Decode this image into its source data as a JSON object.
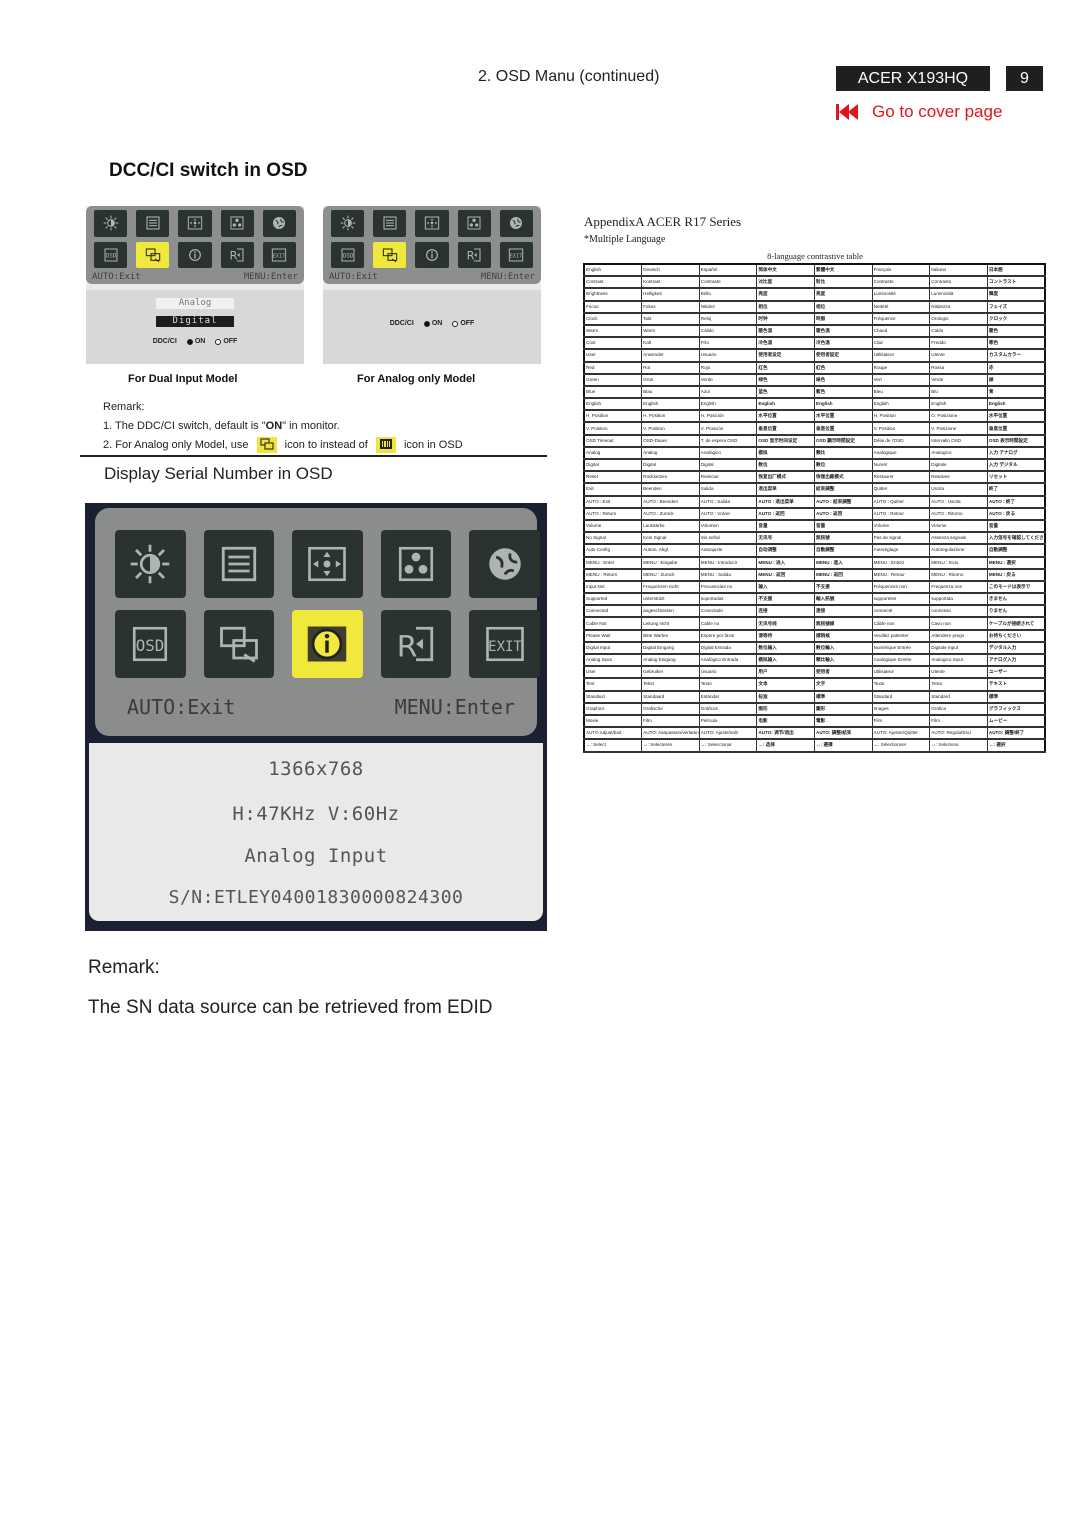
{
  "header": {
    "section": "2. OSD Manu (continued)",
    "model": "ACER X193HQ",
    "page_number": "9",
    "cover_link": "Go to cover page",
    "accent_color": "#e0141c"
  },
  "dcc_section": {
    "title": "DCC/CI switch in OSD",
    "osd_footer_left": "AUTO:Exit",
    "osd_footer_right": "MENU:Enter",
    "icons": [
      "brightness-icon",
      "picture-icon",
      "position-icon",
      "color-icon",
      "language-icon",
      "osd-settings-icon",
      "input-select-icon",
      "info-icon",
      "reset-icon",
      "exit-icon"
    ],
    "dual_model": {
      "caption": "For Dual Input Model",
      "option_analog": "Analog",
      "option_digital": "Digital",
      "ddc_label": "DDC/CI",
      "on_label": "ON",
      "off_label": "OFF",
      "selected_icon_index": 6
    },
    "analog_model": {
      "caption": "For Analog only Model",
      "ddc_label": "DDC/CI",
      "on_label": "ON",
      "off_label": "OFF",
      "selected_icon_index": 6
    },
    "remark": {
      "heading": "Remark:",
      "line1_pre": "1. The DDC/CI switch, default is \"",
      "line1_bold": "ON",
      "line1_post": "\" in monitor.",
      "line2_pre": "2. For Analog only Model, use",
      "line2_mid": "icon to instead of",
      "line2_post": "icon in OSD"
    }
  },
  "serial_section": {
    "title": "Display Serial Number in OSD",
    "osd_footer_left": "AUTO:Exit",
    "osd_footer_right": "MENU:Enter",
    "selected_icon_index": 7,
    "resolution": "1366x768",
    "frequency": "H:47KHz V:60Hz",
    "input": "Analog Input",
    "serial": "S/N:ETLEY0400183000082430​0",
    "remark_heading": "Remark:",
    "remark_text": "The SN data source can be retrieved from EDID"
  },
  "appendix": {
    "title": "AppendixA    ACER R17 Series",
    "subtitle": "*Multiple Language",
    "table_caption": "8-language contrastive table",
    "rows": [
      [
        "English",
        "Deutsch",
        "Español",
        "简体中文",
        "繁體中文",
        "Français",
        "Italiano",
        "日本語"
      ],
      [
        "Contrast",
        "Kontrast",
        "Contraste",
        "对比度",
        "對比",
        "Contraste",
        "Contrasto",
        "コントラスト"
      ],
      [
        "Brightness",
        "Helligkeit",
        "Brillo",
        "亮度",
        "亮度",
        "Luminosité",
        "Luminosità",
        "輝度"
      ],
      [
        "Focus",
        "Fokus",
        "Nitidez",
        "相位",
        "相位",
        "Netteté",
        "Nitidezza",
        "フェイズ"
      ],
      [
        "Clock",
        "Takt",
        "Reloj",
        "时钟",
        "時脈",
        "Fréquence",
        "Orologio",
        "クロック"
      ],
      [
        "Warm",
        "Warm",
        "Cálido",
        "暖色温",
        "暖色溫",
        "Chaud",
        "Caldo",
        "暖色"
      ],
      [
        "Cool",
        "Kalt",
        "Frío",
        "冷色温",
        "冷色溫",
        "Clair",
        "Freddo",
        "寒色"
      ],
      [
        "User",
        "Anwender",
        "Usuario",
        "使用者设定",
        "使用者設定",
        "Utilisateur",
        "Utente",
        "カスタムカラー"
      ],
      [
        "Red",
        "Rot",
        "Rojo",
        "红色",
        "紅色",
        "Rouge",
        "Rossa",
        "赤"
      ],
      [
        "Green",
        "Grün",
        "Verde",
        "绿色",
        "綠色",
        "Vert",
        "Verde",
        "緑"
      ],
      [
        "Blue",
        "Blau",
        "Azul",
        "蓝色",
        "藍色",
        "Bleu",
        "Blu",
        "青"
      ],
      [
        "English",
        "English",
        "English",
        "English",
        "English",
        "English",
        "English",
        "English"
      ],
      [
        "H. Position",
        "H. Position",
        "H. Posición",
        "水平位置",
        "水平位置",
        "H. Position",
        "O. Posizione",
        "水平位置"
      ],
      [
        "V. Position",
        "V. Position",
        "V. Posición",
        "垂直位置",
        "垂直位置",
        "V. Position",
        "V. Posizione",
        "垂直位置"
      ],
      [
        "OSD Timeout",
        "OSD-Dauer",
        "T. de espera OSD",
        "OSD 显示时间设定",
        "OSD 顯示時間設定",
        "Délai de l'OSD",
        "Intervallo OSD",
        "OSD 表示時間設定"
      ],
      [
        "Analog",
        "Analog",
        "Analógico",
        "模拟",
        "類比",
        "Analogique",
        "Analogico",
        "入力 アナログ"
      ],
      [
        "Digital",
        "Digital",
        "Digital",
        "数位",
        "數位",
        "Numér",
        "Digitale",
        "入力 デジタル"
      ],
      [
        "Reset",
        "Rücksetzen",
        "Reiniciar",
        "恢复出厂模式",
        "恢復出廠模式",
        "Restaurer",
        "Resetare",
        "リセット"
      ],
      [
        "Exit",
        "Beenden",
        "Salida",
        "退出菜单",
        "結束調整",
        "Quitter",
        "Uscita",
        "終了"
      ],
      [
        "AUTO : Exit",
        "AUTO : Beenden",
        "AUTO : Salida",
        "AUTO : 退出菜单",
        "AUTO : 結束調整",
        "AUTO : Quitter",
        "AUTO : Uscita",
        "AUTO : 終了"
      ],
      [
        "AUTO : Return",
        "AUTO : Zurück",
        "AUTO : Volver",
        "AUTO : 返回",
        "AUTO : 返回",
        "AUTO : Retour",
        "AUTO : Ritorno",
        "AUTO : 戻る"
      ],
      [
        "Volume",
        "Lautstärke",
        "Volumen",
        "音量",
        "音量",
        "Volume",
        "Volume",
        "音量"
      ],
      [
        "No Signal",
        "Kein Signal",
        "Sin señal",
        "无讯号",
        "無訊號",
        "Pas de signal",
        "Assenza segnale",
        "入力信号を確認してください"
      ],
      [
        "Auto Config",
        "Autom. Abgl.",
        "Autoajuste",
        "自动调整",
        "自動調整",
        "Autoréglage",
        "Autoregolazione",
        "自動調整"
      ],
      [
        "MENU : Enter",
        "MENU : Eingabe",
        "MENU : Introducir",
        "MENU : 进入",
        "MENU : 進入",
        "MENU : Entrez",
        "MENU : Invio",
        "MENU : 選択"
      ],
      [
        "MENU : Return",
        "MENU : Zurück",
        "MENU : Salida",
        "MENU : 返回",
        "MENU : 返回",
        "MENU : Retour",
        "MENU : Ritorno",
        "MENU : 戻る"
      ],
      [
        "Input Not",
        "Frequenzen nicht",
        "Frecuencias no",
        "输入",
        "不支援",
        "Fréquences non",
        "Frequenza non",
        "このモードは表示で"
      ],
      [
        "Supported",
        "unterstützt",
        "soportadas",
        "不支援",
        "輸入訊號",
        "supportées",
        "supportata",
        "きません"
      ],
      [
        "Connected",
        "angeschlossen",
        "Conectado",
        "连接",
        "連接",
        "connecté",
        "connesso",
        "りません"
      ],
      [
        "Cable Not",
        "Leitung nicht",
        "Cable no",
        "无讯号线",
        "無訊號線",
        "Câble non",
        "Cavo non",
        "ケーブルが接続されて"
      ],
      [
        "Please Wait",
        "Bitte Warten",
        "Espere por favor",
        "请等待",
        "請稍候",
        "Veuillez patienter",
        "Attendere prego",
        "お待ちください"
      ],
      [
        "Digital Input",
        "Digital Eingang",
        "Digital Entrada",
        "数位输入",
        "數位輸入",
        "Numérique Entrée",
        "Digitale Input",
        "デジタル入力"
      ],
      [
        "Analog Input",
        "Analog Eingang",
        "Analógico Entrada",
        "模拟输入",
        "類比輸入",
        "Analogique Entrée",
        "Analogico Input",
        "アナログ入力"
      ],
      [
        "User",
        "Gebruiker",
        "Usuario",
        "用户",
        "使用者",
        "Utilisateur",
        "Utente",
        "ユーザー"
      ],
      [
        "Text",
        "Tekst",
        "Texto",
        "文本",
        "文字",
        "Texte",
        "Testo",
        "テキスト"
      ],
      [
        "Standard",
        "Standaard",
        "Estándar",
        "标准",
        "標準",
        "Standard",
        "Standard",
        "標準"
      ],
      [
        "Graphics",
        "Grafische",
        "Gráficos",
        "图形",
        "圖形",
        "Images",
        "Grafica",
        "グラフィックス"
      ],
      [
        "Movie",
        "Film",
        "Película",
        "电影",
        "電影",
        "Film",
        "Film",
        "ムービー"
      ],
      [
        "AUTO Adjust/Exit",
        "AUTO: Aanpassen/verlaten",
        "AUTO: Ajuste/salir",
        "AUTO: 调节/退出",
        "AUTO: 調整/結束",
        "AUTO: Ajuster/Quitter",
        "AUTO: Regola/Esci",
        "AUTO: 調整/終了"
      ],
      [
        "↔: Select",
        "↔: Selecteren",
        "↔: Seleccionar",
        "↔: 选择",
        "↔: 選擇",
        "↔: Sélectionner",
        "↔: Seleziona",
        "↔: 選択"
      ]
    ]
  }
}
